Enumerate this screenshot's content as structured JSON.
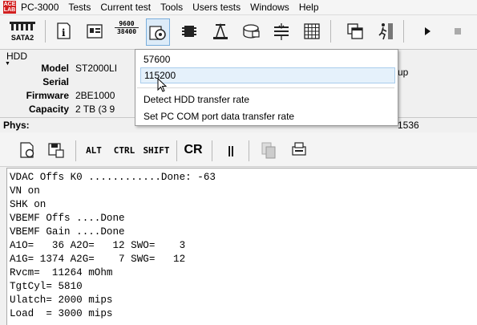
{
  "app": {
    "logo_text": "ACE\nLAB",
    "title": "PC-3000"
  },
  "menu": [
    "Tests",
    "Current test",
    "Tools",
    "Users tests",
    "Windows",
    "Help"
  ],
  "toolbar": {
    "sata_label": "SATA2",
    "baud_icon_text": [
      "9600",
      "38400"
    ],
    "icons": [
      "port-icon",
      "info-icon",
      "id-card-icon",
      "baud-rate-icon",
      "settings-gear-icon",
      "chip-icon",
      "tools-icon",
      "disk-icon",
      "layers-icon",
      "grid-icon",
      "copy-windows-icon",
      "exit-icon",
      "play-icon",
      "stop-icon"
    ]
  },
  "hdd": {
    "title": "HDD",
    "fields": [
      {
        "label": "Model",
        "value": "ST2000LI"
      },
      {
        "label": "Serial",
        "value": ""
      },
      {
        "label": "Firmware",
        "value": "2BE1000"
      },
      {
        "label": "Capacity",
        "value": "2 TB (3 9"
      }
    ],
    "right_fragment": "up"
  },
  "phys": {
    "label": "Phys:",
    "value": "1536"
  },
  "terminal_toolbar": {
    "buttons": [
      "ALT",
      "CTRL",
      "SHIFT",
      "CR",
      "||"
    ]
  },
  "terminal": {
    "lines": [
      "VDAC Offs K0 ............Done: -63",
      "VN on",
      "SHK on",
      "VBEMF Offs ....Done",
      "VBEMF Gain ....Done",
      "A1O=   36 A2O=   12 SWO=    3",
      "A1G= 1374 A2G=    7 SWG=   12",
      "Rvcm=  11264 mOhm",
      "TgtCyl= 5810",
      "Ulatch= 2000 mips",
      "Load  = 3000 mips"
    ]
  },
  "dropdown": {
    "items": [
      "57600",
      "115200",
      "Detect HDD transfer rate",
      "Set PC COM port data transfer rate"
    ],
    "highlighted": "115200"
  }
}
